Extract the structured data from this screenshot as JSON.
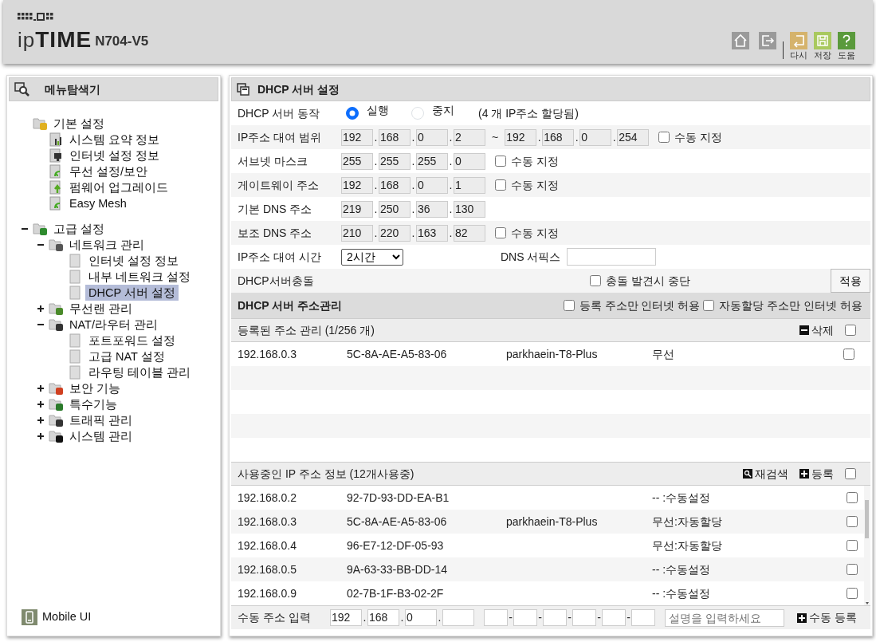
{
  "header": {
    "logo": "ip**TIME**",
    "model": "N704-V5",
    "actions": [
      {
        "kind": "undo",
        "label": "다시"
      },
      {
        "kind": "save",
        "label": "저장"
      },
      {
        "kind": "help",
        "label": "도움"
      }
    ]
  },
  "sidebar": {
    "title": "메뉴탐색기",
    "tree": [
      {
        "label": "기본 설정",
        "kind": "folder",
        "selected": false,
        "children": [
          {
            "label": "시스템 요약 정보",
            "kind": "page",
            "selected": false
          },
          {
            "label": "인터넷 설정 정보",
            "kind": "page",
            "selected": false
          },
          {
            "label": "무선 설정/보안",
            "kind": "page",
            "selected": false
          },
          {
            "label": "펌웨어 업그레이드",
            "kind": "page",
            "selected": false
          },
          {
            "label": "Easy Mesh",
            "kind": "page",
            "selected": false
          }
        ]
      },
      {
        "label": "고급 설정",
        "kind": "folder",
        "expanded": true,
        "selected": false,
        "children": [
          {
            "label": "네트워크 관리",
            "kind": "folder",
            "expanded": true,
            "selected": false,
            "children": [
              {
                "label": "인터넷 설정 정보",
                "kind": "leaf",
                "selected": false
              },
              {
                "label": "내부 네트워크 설정",
                "kind": "leaf",
                "selected": false
              },
              {
                "label": "DHCP 서버 설정",
                "kind": "leaf",
                "selected": true
              }
            ]
          },
          {
            "label": "무선랜 관리",
            "kind": "folder",
            "expanded": false,
            "selected": false
          },
          {
            "label": "NAT/라우터 관리",
            "kind": "folder",
            "expanded": true,
            "selected": false,
            "children": [
              {
                "label": "포트포워드 설정",
                "kind": "leaf",
                "selected": false
              },
              {
                "label": "고급 NAT 설정",
                "kind": "leaf",
                "selected": false
              },
              {
                "label": "라우팅 테이블 관리",
                "kind": "leaf",
                "selected": false
              }
            ]
          },
          {
            "label": "보안 기능",
            "kind": "folder",
            "expanded": false,
            "selected": false
          },
          {
            "label": "특수기능",
            "kind": "folder",
            "expanded": false,
            "selected": false
          },
          {
            "label": "트래픽 관리",
            "kind": "folder",
            "expanded": false,
            "selected": false
          },
          {
            "label": "시스템 관리",
            "kind": "folder",
            "expanded": false,
            "selected": false
          }
        ]
      }
    ],
    "footer_link": "Mobile UI"
  },
  "panel": {
    "title": "DHCP 서버 설정",
    "form": [
      {
        "kind": "radio",
        "label": "DHCP 서버 동작",
        "options": [
          {
            "label": "실행",
            "selected": true
          },
          {
            "label": "중지",
            "selected": false
          }
        ],
        "note": "(4 개 IP주소 할당됨)"
      },
      {
        "kind": "ip",
        "label": "IP주소 대여 범위",
        "ranges": [
          [
            "192",
            "168",
            "0",
            "2"
          ],
          [
            "192",
            "168",
            "0",
            "254"
          ]
        ],
        "separator": ".",
        "range_separator": "~",
        "manual": {
          "label": "수동 지정",
          "checked": false
        }
      },
      {
        "kind": "ip",
        "label": "서브넷 마스크",
        "ranges": [
          [
            "255",
            "255",
            "255",
            "0"
          ]
        ],
        "separator": ".",
        "manual": {
          "label": "수동 지정",
          "checked": false
        }
      },
      {
        "kind": "ip",
        "label": "게이트웨이 주소",
        "ranges": [
          [
            "192",
            "168",
            "0",
            "1"
          ]
        ],
        "separator": ".",
        "manual": {
          "label": "수동 지정",
          "checked": false
        }
      },
      {
        "kind": "ip",
        "label": "기본 DNS 주소",
        "ranges": [
          [
            "219",
            "250",
            "36",
            "130"
          ]
        ],
        "separator": "."
      },
      {
        "kind": "ip",
        "label": "보조 DNS 주소",
        "ranges": [
          [
            "210",
            "220",
            "163",
            "82"
          ]
        ],
        "separator": ".",
        "manual": {
          "label": "수동 지정",
          "checked": false
        }
      },
      {
        "kind": "lease",
        "label": "IP주소 대여 시간",
        "value": "2시간",
        "suffix_label": "DNS 서픽스"
      },
      {
        "kind": "conflict",
        "label": "DHCP서버충돌",
        "option": {
          "label": "충돌 발견시 중단",
          "checked": false
        },
        "button": "적용"
      }
    ],
    "address_section": {
      "title": "DHCP 서버 주소관리",
      "options": [
        {
          "label": "등록 주소만 인터넷 허용",
          "checked": false
        },
        {
          "label": "자동할당 주소만 인터넷 허용",
          "checked": false
        }
      ],
      "registered": {
        "title": "등록된 주소 관리 (1/256 개)",
        "actions": [
          {
            "kind": "delete",
            "label": "삭제"
          }
        ],
        "all_checked": false,
        "rows": [
          {
            "ip": "192.168.0.3",
            "mac": "5C-8A-AE-A5-83-06",
            "name": "parkhaein-T8-Plus",
            "type": "무선",
            "checked": false
          }
        ]
      },
      "in_use": {
        "title": "사용중인 IP 주소 정보 (12개사용중)",
        "actions": [
          {
            "kind": "rescan",
            "label": "재검색"
          },
          {
            "kind": "add",
            "label": "등록"
          }
        ],
        "all_checked": false,
        "rows": [
          {
            "ip": "192.168.0.2",
            "mac": "92-7D-93-DD-EA-B1",
            "type": "-- :수동설정",
            "checked": false
          },
          {
            "ip": "192.168.0.3",
            "mac": "5C-8A-AE-A5-83-06",
            "name": "parkhaein-T8-Plus",
            "type": "무선:자동할당",
            "checked": false
          },
          {
            "ip": "192.168.0.4",
            "mac": "96-E7-12-DF-05-93",
            "type": "무선:자동할당",
            "checked": false
          },
          {
            "ip": "192.168.0.5",
            "mac": "9A-63-33-BB-DD-14",
            "type": "-- :수동설정",
            "checked": false
          },
          {
            "ip": "192.168.0.9",
            "mac": "02-7B-1F-B3-02-2F",
            "type": "-- :수동설정",
            "checked": false
          }
        ]
      },
      "manual_entry": {
        "label": "수동 주소 입력",
        "ip": [
          "192",
          "168",
          "0"
        ],
        "separator": ".",
        "mac_separator": "-",
        "placeholder": "설명을 입력하세요",
        "button": "수동 등록"
      }
    }
  }
}
